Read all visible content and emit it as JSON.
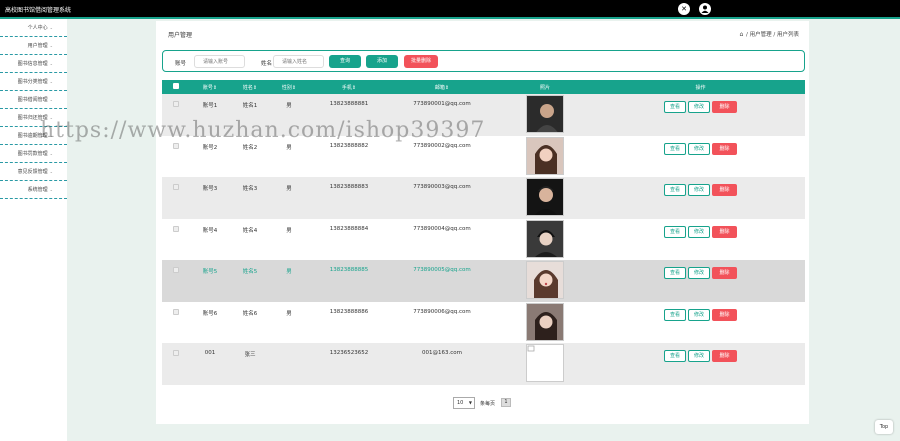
{
  "app": {
    "title": "高校图书馆借阅管理系统"
  },
  "header": {
    "icons": [
      "close-icon",
      "user-icon"
    ]
  },
  "sidebar": {
    "items": [
      {
        "label": "个人中心"
      },
      {
        "label": "用户管理"
      },
      {
        "label": "图书信息管理"
      },
      {
        "label": "图书分类管理"
      },
      {
        "label": "图书借阅管理"
      },
      {
        "label": "图书归还管理"
      },
      {
        "label": "图书逾期管理"
      },
      {
        "label": "图书罚款管理"
      },
      {
        "label": "意见反馈管理"
      },
      {
        "label": "系统管理"
      }
    ]
  },
  "page": {
    "title": "用户管理",
    "breadcrumb": [
      "用户管理",
      "用户列表"
    ]
  },
  "search": {
    "account_label": "账号",
    "account_placeholder": "请输入账号",
    "name_label": "姓名",
    "name_placeholder": "请输入姓名",
    "query_label": "查询",
    "add_label": "添加",
    "batch_delete_label": "批量删除"
  },
  "table": {
    "columns": [
      "账号",
      "姓名",
      "性别",
      "手机",
      "邮箱",
      "照片",
      "操作"
    ],
    "actions": {
      "view": "查看",
      "edit": "修改",
      "delete": "删除"
    },
    "rows": [
      {
        "account": "账号1",
        "name": "姓名1",
        "gender": "男",
        "phone": "13823888881",
        "email": "773890001@qq.com",
        "photo": "photo-1"
      },
      {
        "account": "账号2",
        "name": "姓名2",
        "gender": "男",
        "phone": "13823888882",
        "email": "773890002@qq.com",
        "photo": "photo-2"
      },
      {
        "account": "账号3",
        "name": "姓名3",
        "gender": "男",
        "phone": "13823888883",
        "email": "773890003@qq.com",
        "photo": "photo-3"
      },
      {
        "account": "账号4",
        "name": "姓名4",
        "gender": "男",
        "phone": "13823888884",
        "email": "773890004@qq.com",
        "photo": "photo-4"
      },
      {
        "account": "账号5",
        "name": "姓名5",
        "gender": "男",
        "phone": "13823888885",
        "email": "773890005@qq.com",
        "photo": "photo-5"
      },
      {
        "account": "账号6",
        "name": "姓名6",
        "gender": "男",
        "phone": "13823888886",
        "email": "773890006@qq.com",
        "photo": "photo-6"
      },
      {
        "account": "001",
        "name": "张三",
        "gender": "",
        "phone": "13236523652",
        "email": "001@163.com",
        "photo": "broken-image"
      }
    ]
  },
  "pagination": {
    "page_size": "10",
    "per_page_label": "条每页",
    "current_page": "1"
  },
  "watermark": "https://www.huzhan.com/ishop39397",
  "back_to_top": "Top",
  "colors": {
    "accent": "#17a38c",
    "danger": "#f2525a",
    "topbar": "#000000"
  }
}
